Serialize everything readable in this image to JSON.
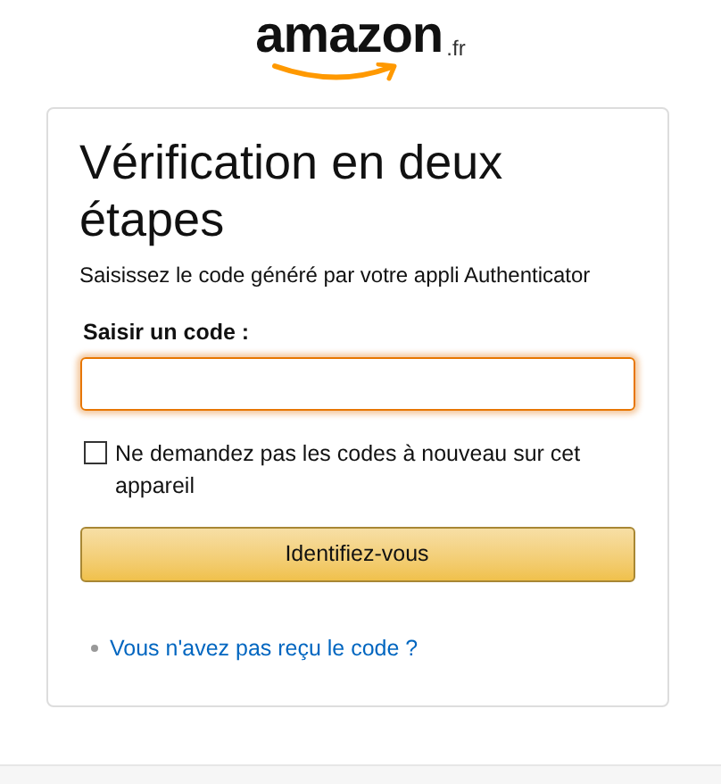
{
  "logo": {
    "wordmark": "amazon",
    "suffix": ".fr"
  },
  "card": {
    "title": "Vérification en deux étapes",
    "subtitle": "Saisissez le code généré par votre appli Authenticator",
    "code_field": {
      "label": "Saisir un code :",
      "focused": true
    },
    "remember_device": {
      "label": "Ne demandez pas les codes à nouveau sur cet appareil",
      "checked": false
    },
    "submit_button": "Identifiez-vous",
    "links": [
      "Vous n'avez pas reçu le code ?"
    ]
  }
}
